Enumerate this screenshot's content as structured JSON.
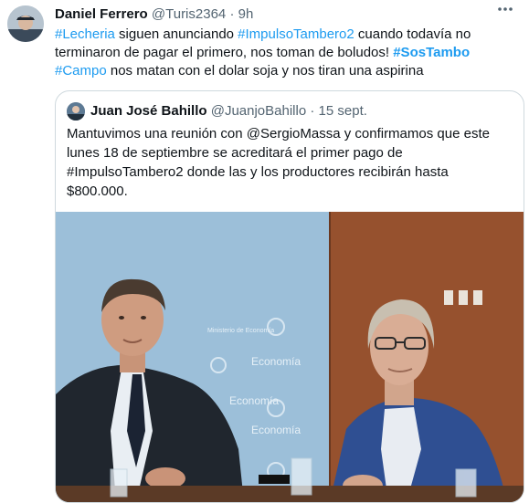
{
  "tweet": {
    "author_name": "Daniel Ferrero",
    "author_handle": "@Turis2364",
    "separator": "·",
    "time": "9h",
    "more_icon": "more-dots-icon",
    "line1": {
      "hashtag1": "#Lecheria",
      "text1": " siguen anunciando ",
      "hashtag2": "#ImpulsoTambero2",
      "text2": " cuando todavía no"
    },
    "line2": {
      "text": "terminaron de pagar el primero, nos toman de boludos! ",
      "hashtag": "#SosTambo"
    },
    "line3": {
      "hashtag": "#Campo",
      "text": " nos matan con el dolar soja y nos tiran una aspirina"
    }
  },
  "quote": {
    "author_name": "Juan José Bahillo",
    "author_handle": "@JuanjoBahillo",
    "separator": "·",
    "date": "15 sept.",
    "lines": [
      "Mantuvimos una reunión con @SergioMassa y confirmamos que este",
      "lunes 18 de septiembre se acreditará el primer pago de",
      "#ImpulsoTambero2 donde las y los productores recibirán hasta",
      "$800.000."
    ],
    "photo_wall_texts": [
      "Ministerio de Economía",
      "Economía",
      "Economía",
      "Economía"
    ]
  },
  "colors": {
    "link": "#1d9bf0",
    "muted": "#536471",
    "border": "#cfd9de"
  }
}
